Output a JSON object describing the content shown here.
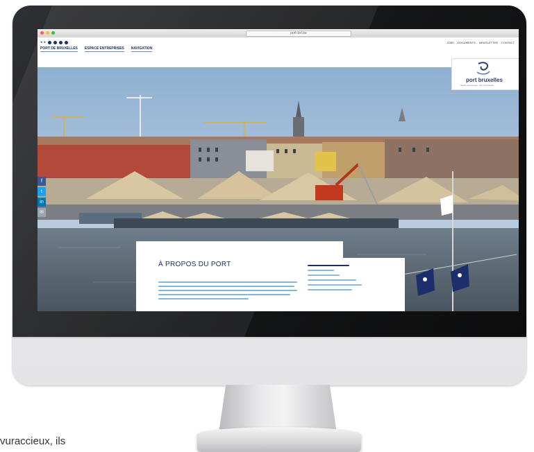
{
  "browser": {
    "url": "port-bxl.be",
    "traffic_colors": [
      "#ff5f57",
      "#febc2e",
      "#28c840"
    ]
  },
  "header": {
    "nav": [
      "PORT DE BRUXELLES",
      "ESPACE ENTREPRISES",
      "NAVIGATION"
    ],
    "utility": [
      "JOBS",
      "DOCUMENTS",
      "NEWSLETTER",
      "CONTACT"
    ],
    "logo_text": "port bruxelles",
    "logo_sub": "haven van brussel · port of brussels",
    "brand_color": "#1d2f6b"
  },
  "about": {
    "title": "À PROPOS DU PORT"
  },
  "side_social": [
    {
      "icon": "facebook-icon",
      "glyph": "f",
      "color": "#3b5998"
    },
    {
      "icon": "twitter-icon",
      "glyph": "t",
      "color": "#1da1f2"
    },
    {
      "icon": "linkedin-icon",
      "glyph": "in",
      "color": "#0077b5"
    },
    {
      "icon": "mail-icon",
      "glyph": "✉",
      "color": "#9aa6b2"
    }
  ],
  "stray_text": "vuraccieux, ils"
}
